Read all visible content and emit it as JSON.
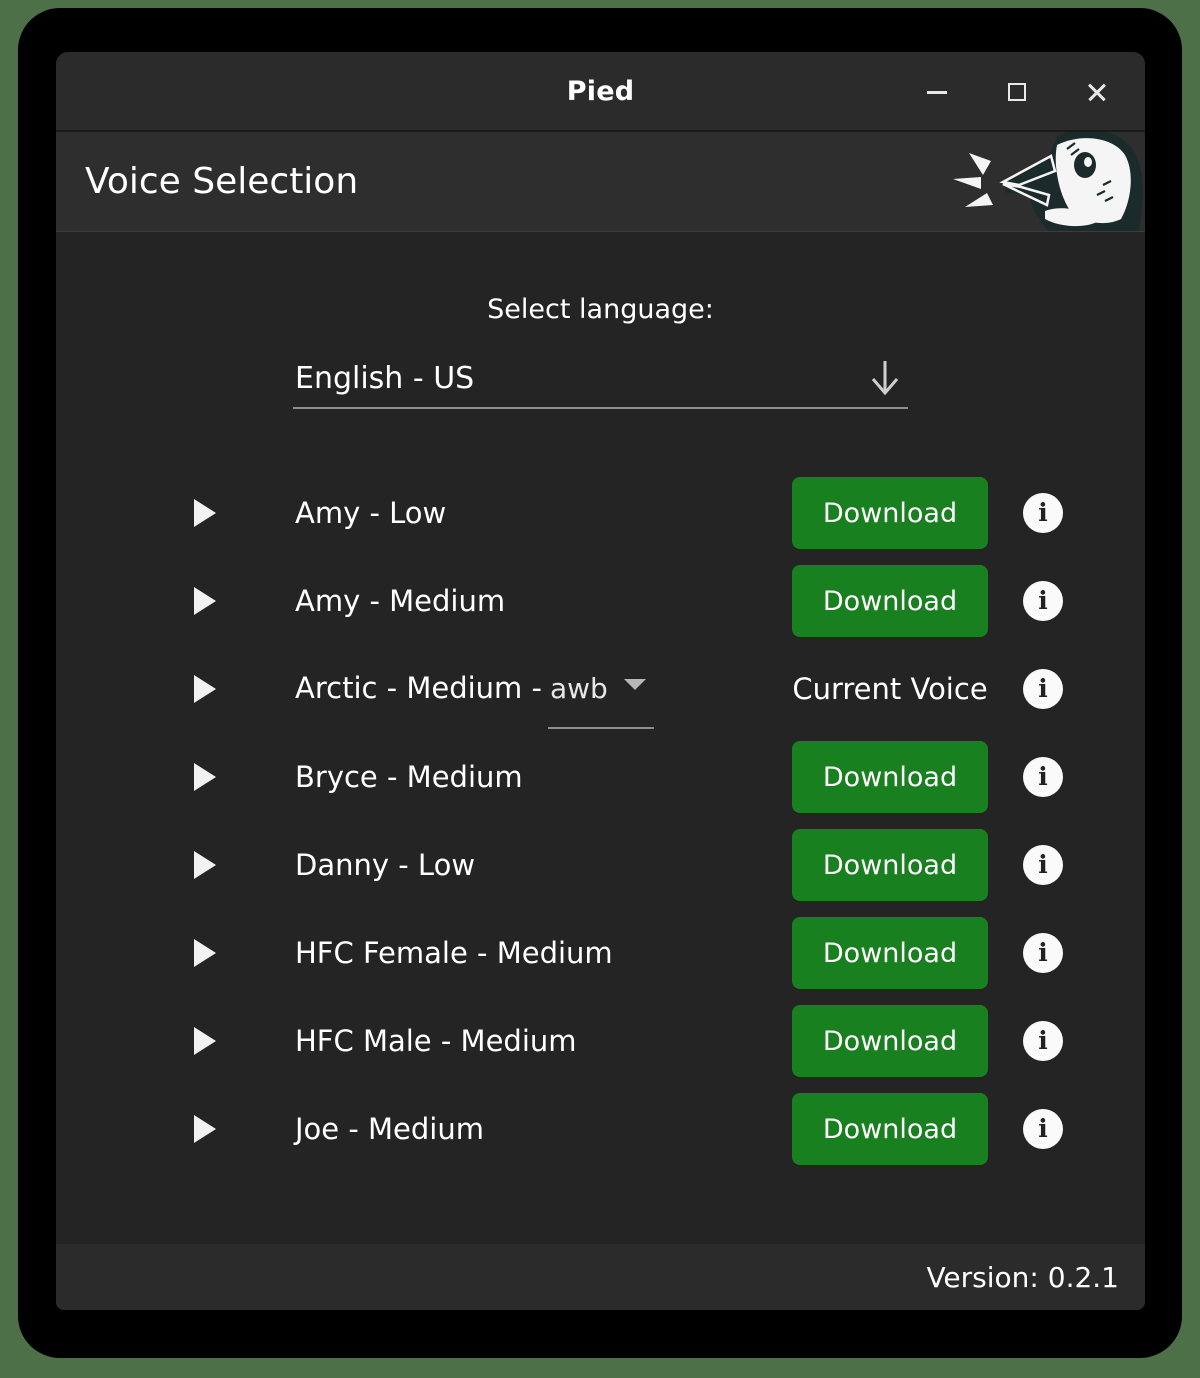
{
  "window": {
    "title": "Pied",
    "controls": {
      "minimize": "minimize",
      "maximize": "maximize",
      "close": "close"
    }
  },
  "header": {
    "page_title": "Voice Selection",
    "logo": "pied-magpie-logo"
  },
  "language": {
    "label": "Select language:",
    "selected": "English - US",
    "dropdown_icon": "arrow-down-icon"
  },
  "voices": [
    {
      "name": "Amy - Low",
      "action_type": "download",
      "action_label": "Download",
      "info_label": "i"
    },
    {
      "name": "Amy - Medium",
      "action_type": "download",
      "action_label": "Download",
      "info_label": "i"
    },
    {
      "name": "Arctic - Medium - ",
      "variant": "awb",
      "has_variant_dropdown": true,
      "action_type": "status",
      "action_label": "Current Voice",
      "info_label": "i"
    },
    {
      "name": "Bryce - Medium",
      "action_type": "download",
      "action_label": "Download",
      "info_label": "i"
    },
    {
      "name": "Danny - Low",
      "action_type": "download",
      "action_label": "Download",
      "info_label": "i"
    },
    {
      "name": "HFC Female - Medium",
      "action_type": "download",
      "action_label": "Download",
      "info_label": "i"
    },
    {
      "name": "HFC Male - Medium",
      "action_type": "download",
      "action_label": "Download",
      "info_label": "i"
    },
    {
      "name": "Joe - Medium",
      "action_type": "download",
      "action_label": "Download",
      "info_label": "i"
    }
  ],
  "footer": {
    "version": "Version: 0.2.1"
  },
  "colors": {
    "accent_green": "#19801f",
    "desktop_background": "#4d7049",
    "window_background": "#242424",
    "titlebar_background": "#2b2b2b",
    "header_background": "#2e2e2e"
  }
}
